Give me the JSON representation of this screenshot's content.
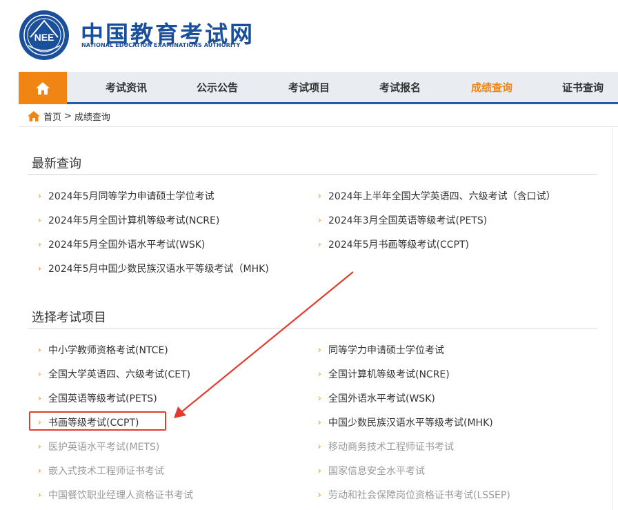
{
  "header": {
    "logo_title": "中国教育考试网",
    "logo_subtitle": "NATIONAL EDUCATION EXAMINATIONS AUTHORITY",
    "seal_text": "NEEA"
  },
  "nav": {
    "home_icon": "home-icon",
    "items": [
      {
        "label": "考试资讯",
        "active": false
      },
      {
        "label": "公示公告",
        "active": false
      },
      {
        "label": "考试项目",
        "active": false
      },
      {
        "label": "考试报名",
        "active": false
      },
      {
        "label": "成绩查询",
        "active": true
      },
      {
        "label": "证书查询",
        "active": false
      }
    ]
  },
  "breadcrumb": {
    "home": "首页",
    "separator": ">",
    "current": "成绩查询"
  },
  "latest": {
    "title": "最新查询",
    "items": [
      "2024年5月同等学力申请硕士学位考试",
      "2024年上半年全国大学英语四、六级考试（含口试）",
      "2024年5月全国计算机等级考试(NCRE)",
      "2024年3月全国英语等级考试(PETS)",
      "2024年5月全国外语水平考试(WSK)",
      "2024年5月书画等级考试(CCPT)",
      "2024年5月中国少数民族汉语水平等级考试（MHK)"
    ]
  },
  "select": {
    "title": "选择考试项目",
    "items": [
      "中小学教师资格考试(NTCE)",
      "同等学力申请硕士学位考试",
      "全国大学英语四、六级考试(CET)",
      "全国计算机等级考试(NCRE)",
      "全国英语等级考试(PETS)",
      "全国外语水平考试(WSK)",
      "书画等级考试(CCPT)",
      "中国少数民族汉语水平等级考试(MHK)",
      "医护英语水平考试(METS)",
      "移动商务技术工程师证书考试",
      "嵌入式技术工程师证书考试",
      "国家信息安全水平考试",
      "中国餐饮职业经理人资格证书考试",
      "劳动和社会保障岗位资格证书考试(LSSEP)"
    ]
  },
  "colors": {
    "brand_blue": "#1a4f9c",
    "accent_orange": "#f08514",
    "annotation_red": "#e03b2e"
  },
  "chevron": "›"
}
